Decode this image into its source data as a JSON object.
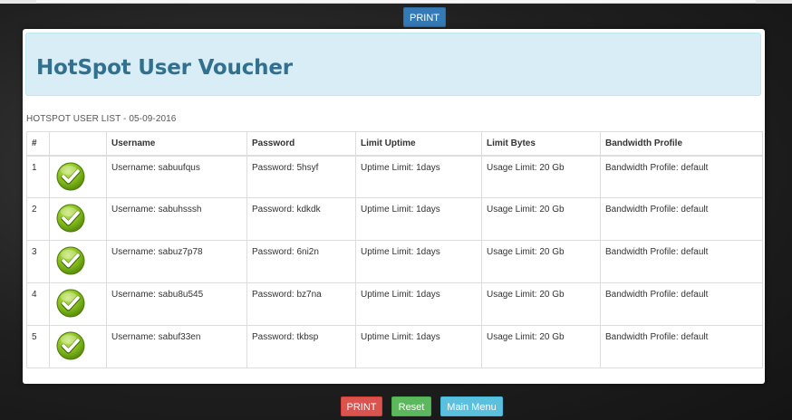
{
  "toolbar_top": {
    "print_label": "PRINT"
  },
  "panel": {
    "title": "HotSpot User Voucher",
    "caption": "HOTSPOT USER LIST - 05-09-2016"
  },
  "table": {
    "columns": [
      "#",
      "",
      "Username",
      "Password",
      "Limit Uptime",
      "Limit Bytes",
      "Bandwidth Profile"
    ],
    "rows": [
      {
        "num": "1",
        "icon": "check-icon",
        "username": "Username: sabuufqus",
        "password": "Password: 5hsyf",
        "uptime": "Uptime Limit: 1days",
        "bytes": "Usage Limit: 20 Gb",
        "profile": "Bandwidth Profile: default"
      },
      {
        "num": "2",
        "icon": "check-icon",
        "username": "Username: sabuhsssh",
        "password": "Password: kdkdk",
        "uptime": "Uptime Limit: 1days",
        "bytes": "Usage Limit: 20 Gb",
        "profile": "Bandwidth Profile: default"
      },
      {
        "num": "3",
        "icon": "check-icon",
        "username": "Username: sabuz7p78",
        "password": "Password: 6ni2n",
        "uptime": "Uptime Limit: 1days",
        "bytes": "Usage Limit: 20 Gb",
        "profile": "Bandwidth Profile: default"
      },
      {
        "num": "4",
        "icon": "check-icon",
        "username": "Username: sabu8u545",
        "password": "Password: bz7na",
        "uptime": "Uptime Limit: 1days",
        "bytes": "Usage Limit: 20 Gb",
        "profile": "Bandwidth Profile: default"
      },
      {
        "num": "5",
        "icon": "check-icon",
        "username": "Username: sabuf33en",
        "password": "Password: tkbsp",
        "uptime": "Uptime Limit: 1days",
        "bytes": "Usage Limit: 20 Gb",
        "profile": "Bandwidth Profile: default"
      }
    ]
  },
  "toolbar_bottom": {
    "print_label": "PRINT",
    "reset_label": "Reset",
    "menu_label": "Main Menu"
  },
  "colors": {
    "print_top": "#337ab7",
    "print_bottom": "#d9534f",
    "reset": "#5cb85c",
    "main_menu": "#5bc0de",
    "header_bg": "#d9edf7",
    "title": "#31708f",
    "check_green": "#7cb518"
  }
}
